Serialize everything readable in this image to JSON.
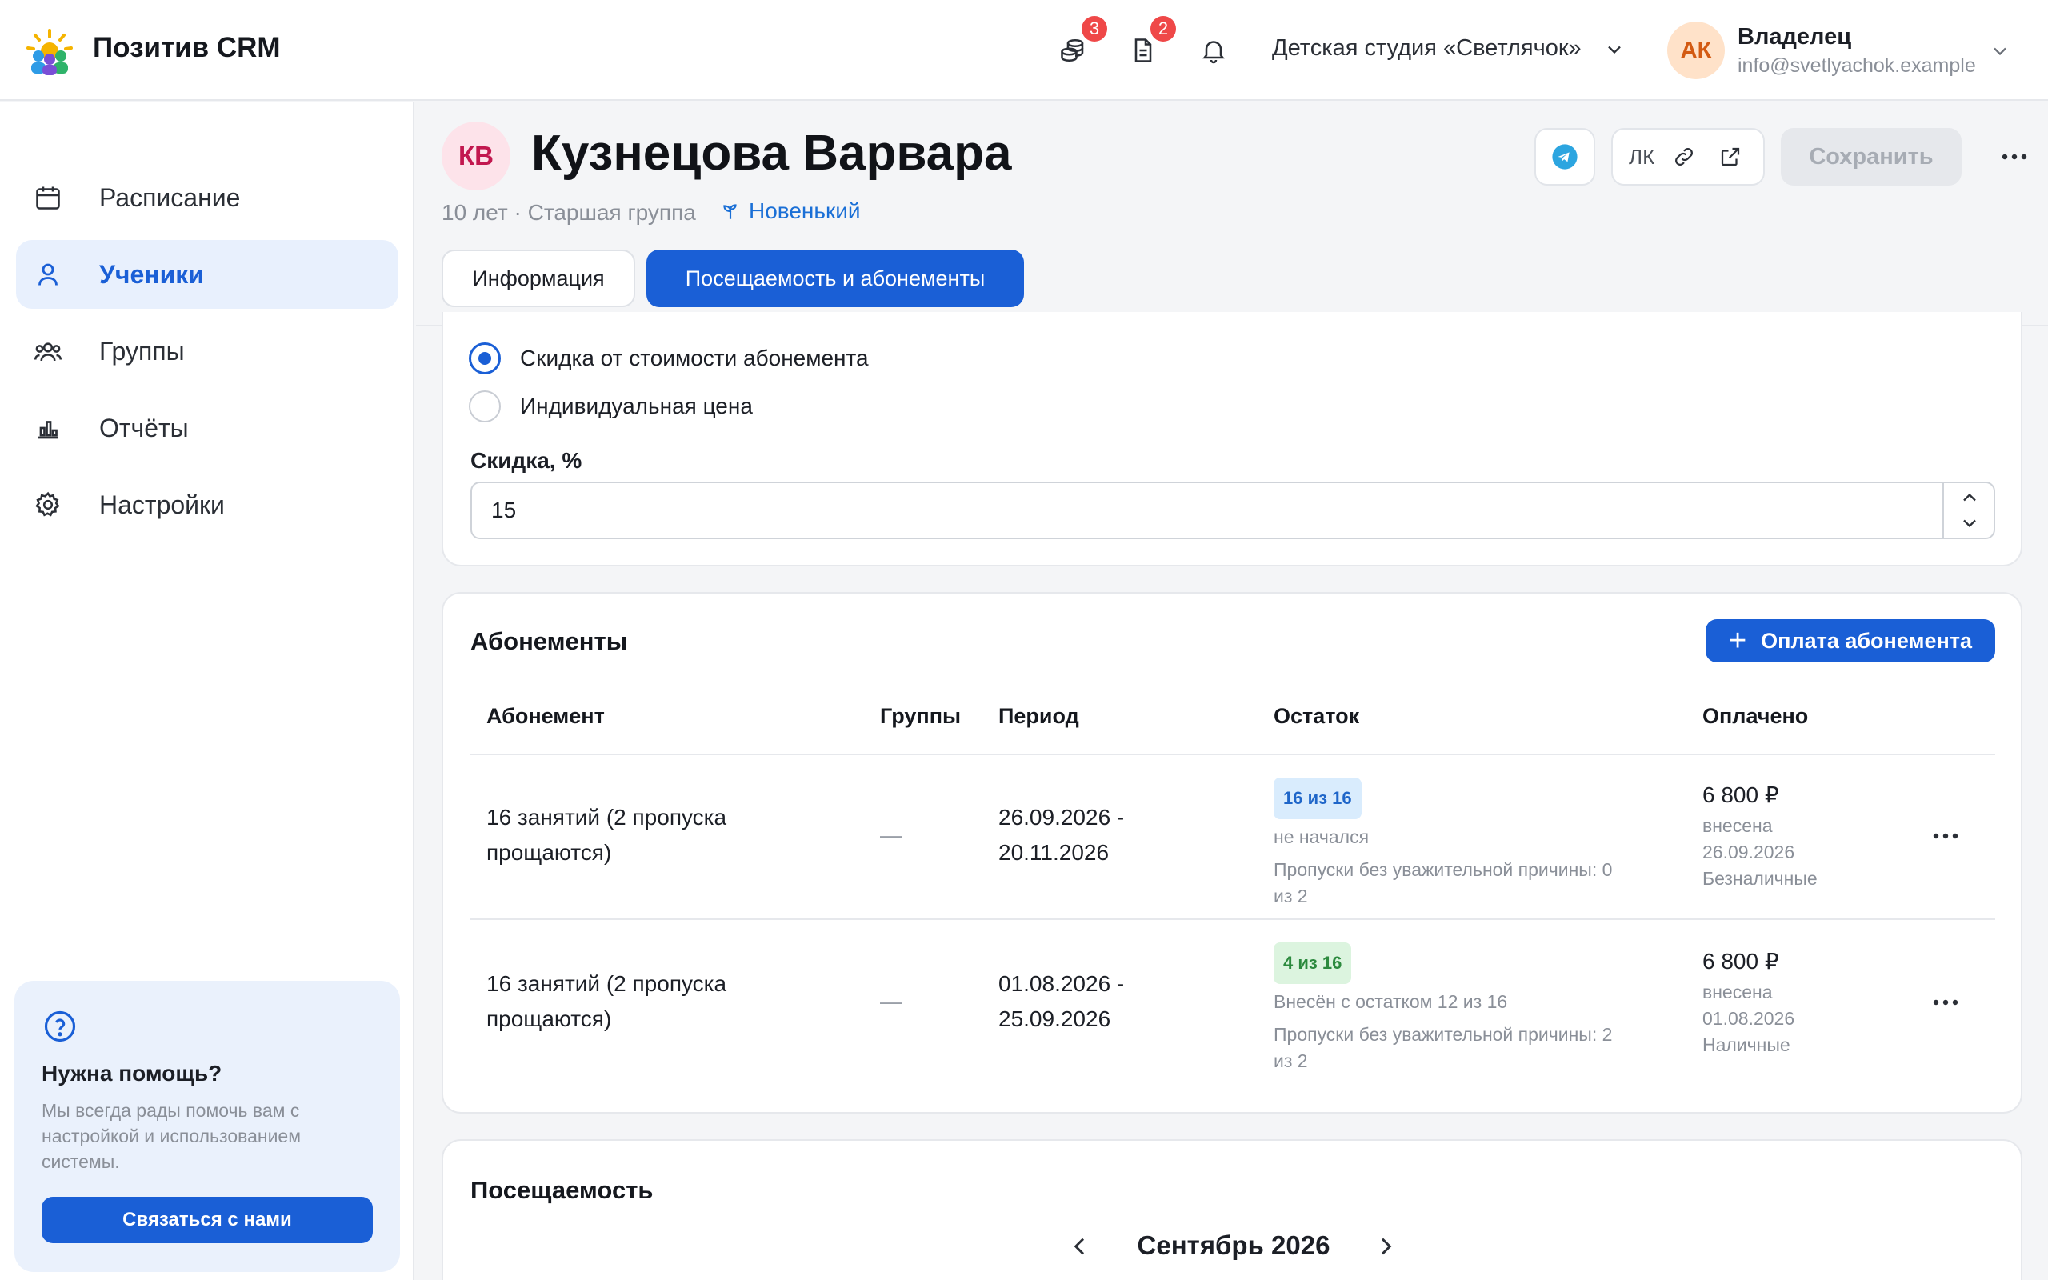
{
  "app": {
    "brand": "Позитив CRM",
    "colors": {
      "accent": "#1a5fd6",
      "badge": "#ef4848",
      "active_nav_bg": "#e8f0fd"
    }
  },
  "topbar": {
    "icons": [
      "coins-icon",
      "document-icon",
      "bell-icon"
    ],
    "coins_badge": "3",
    "docs_badge": "2",
    "studio": "Детская студия «Светлячок»",
    "user": {
      "initials": "АК",
      "role": "Владелец",
      "email": "info@svetlyachok.example"
    }
  },
  "sidebar": {
    "items": [
      {
        "label": "Расписание",
        "icon": "calendar-icon"
      },
      {
        "label": "Ученики",
        "icon": "user-icon",
        "active": true
      },
      {
        "label": "Группы",
        "icon": "users-icon"
      },
      {
        "label": "Отчёты",
        "icon": "chart-icon"
      },
      {
        "label": "Настройки",
        "icon": "gear-icon"
      }
    ],
    "help": {
      "title": "Нужна помощь?",
      "text": "Мы всегда рады помочь вам с настройкой и использованием системы.",
      "button": "Связаться с нами"
    }
  },
  "student": {
    "initials": "КВ",
    "name": "Кузнецова Варвара",
    "subtitle": "10 лет · Старшая группа",
    "tag": "Новенький",
    "lk_label": "ЛК",
    "save_label": "Сохранить",
    "tabs": {
      "info": "Информация",
      "attendance": "Посещаемость и абонементы"
    }
  },
  "discount": {
    "option_discount": "Скидка от стоимости абонемента",
    "option_individual": "Индивидуальная цена",
    "selected": "discount",
    "field_label": "Скидка, %",
    "value": "15"
  },
  "subscriptions": {
    "title": "Абонементы",
    "pay_button": "Оплата абонемента",
    "columns": [
      "Абонемент",
      "Группы",
      "Период",
      "Остаток",
      "Оплачено"
    ],
    "rows": [
      {
        "name_line1": "16 занятий (2 пропуска",
        "name_line2": "прощаются)",
        "groups": "—",
        "period_line1": "26.09.2026 -",
        "period_line2": "20.11.2026",
        "remain_pill": "16 из 16",
        "remain_status": "не начался",
        "skips_line1": "Пропуски без уважительной причины: 0",
        "skips_line2": "из 2",
        "paid_amount": "6 800 ₽",
        "paid_label": "внесена",
        "paid_date": "26.09.2026",
        "paid_method": "Безналичные"
      },
      {
        "name_line1": "16 занятий (2 пропуска",
        "name_line2": "прощаются)",
        "groups": "—",
        "period_line1": "01.08.2026 -",
        "period_line2": "25.09.2026",
        "remain_pill": "4 из 16",
        "remain_status": "Внесён с остатком 12 из 16",
        "skips_line1": "Пропуски без уважительной причины: 2",
        "skips_line2": "из 2",
        "paid_amount": "6 800 ₽",
        "paid_label": "внесена",
        "paid_date": "01.08.2026",
        "paid_method": "Наличные"
      }
    ]
  },
  "attendance": {
    "title": "Посещаемость",
    "month": "Сентябрь 2026"
  }
}
